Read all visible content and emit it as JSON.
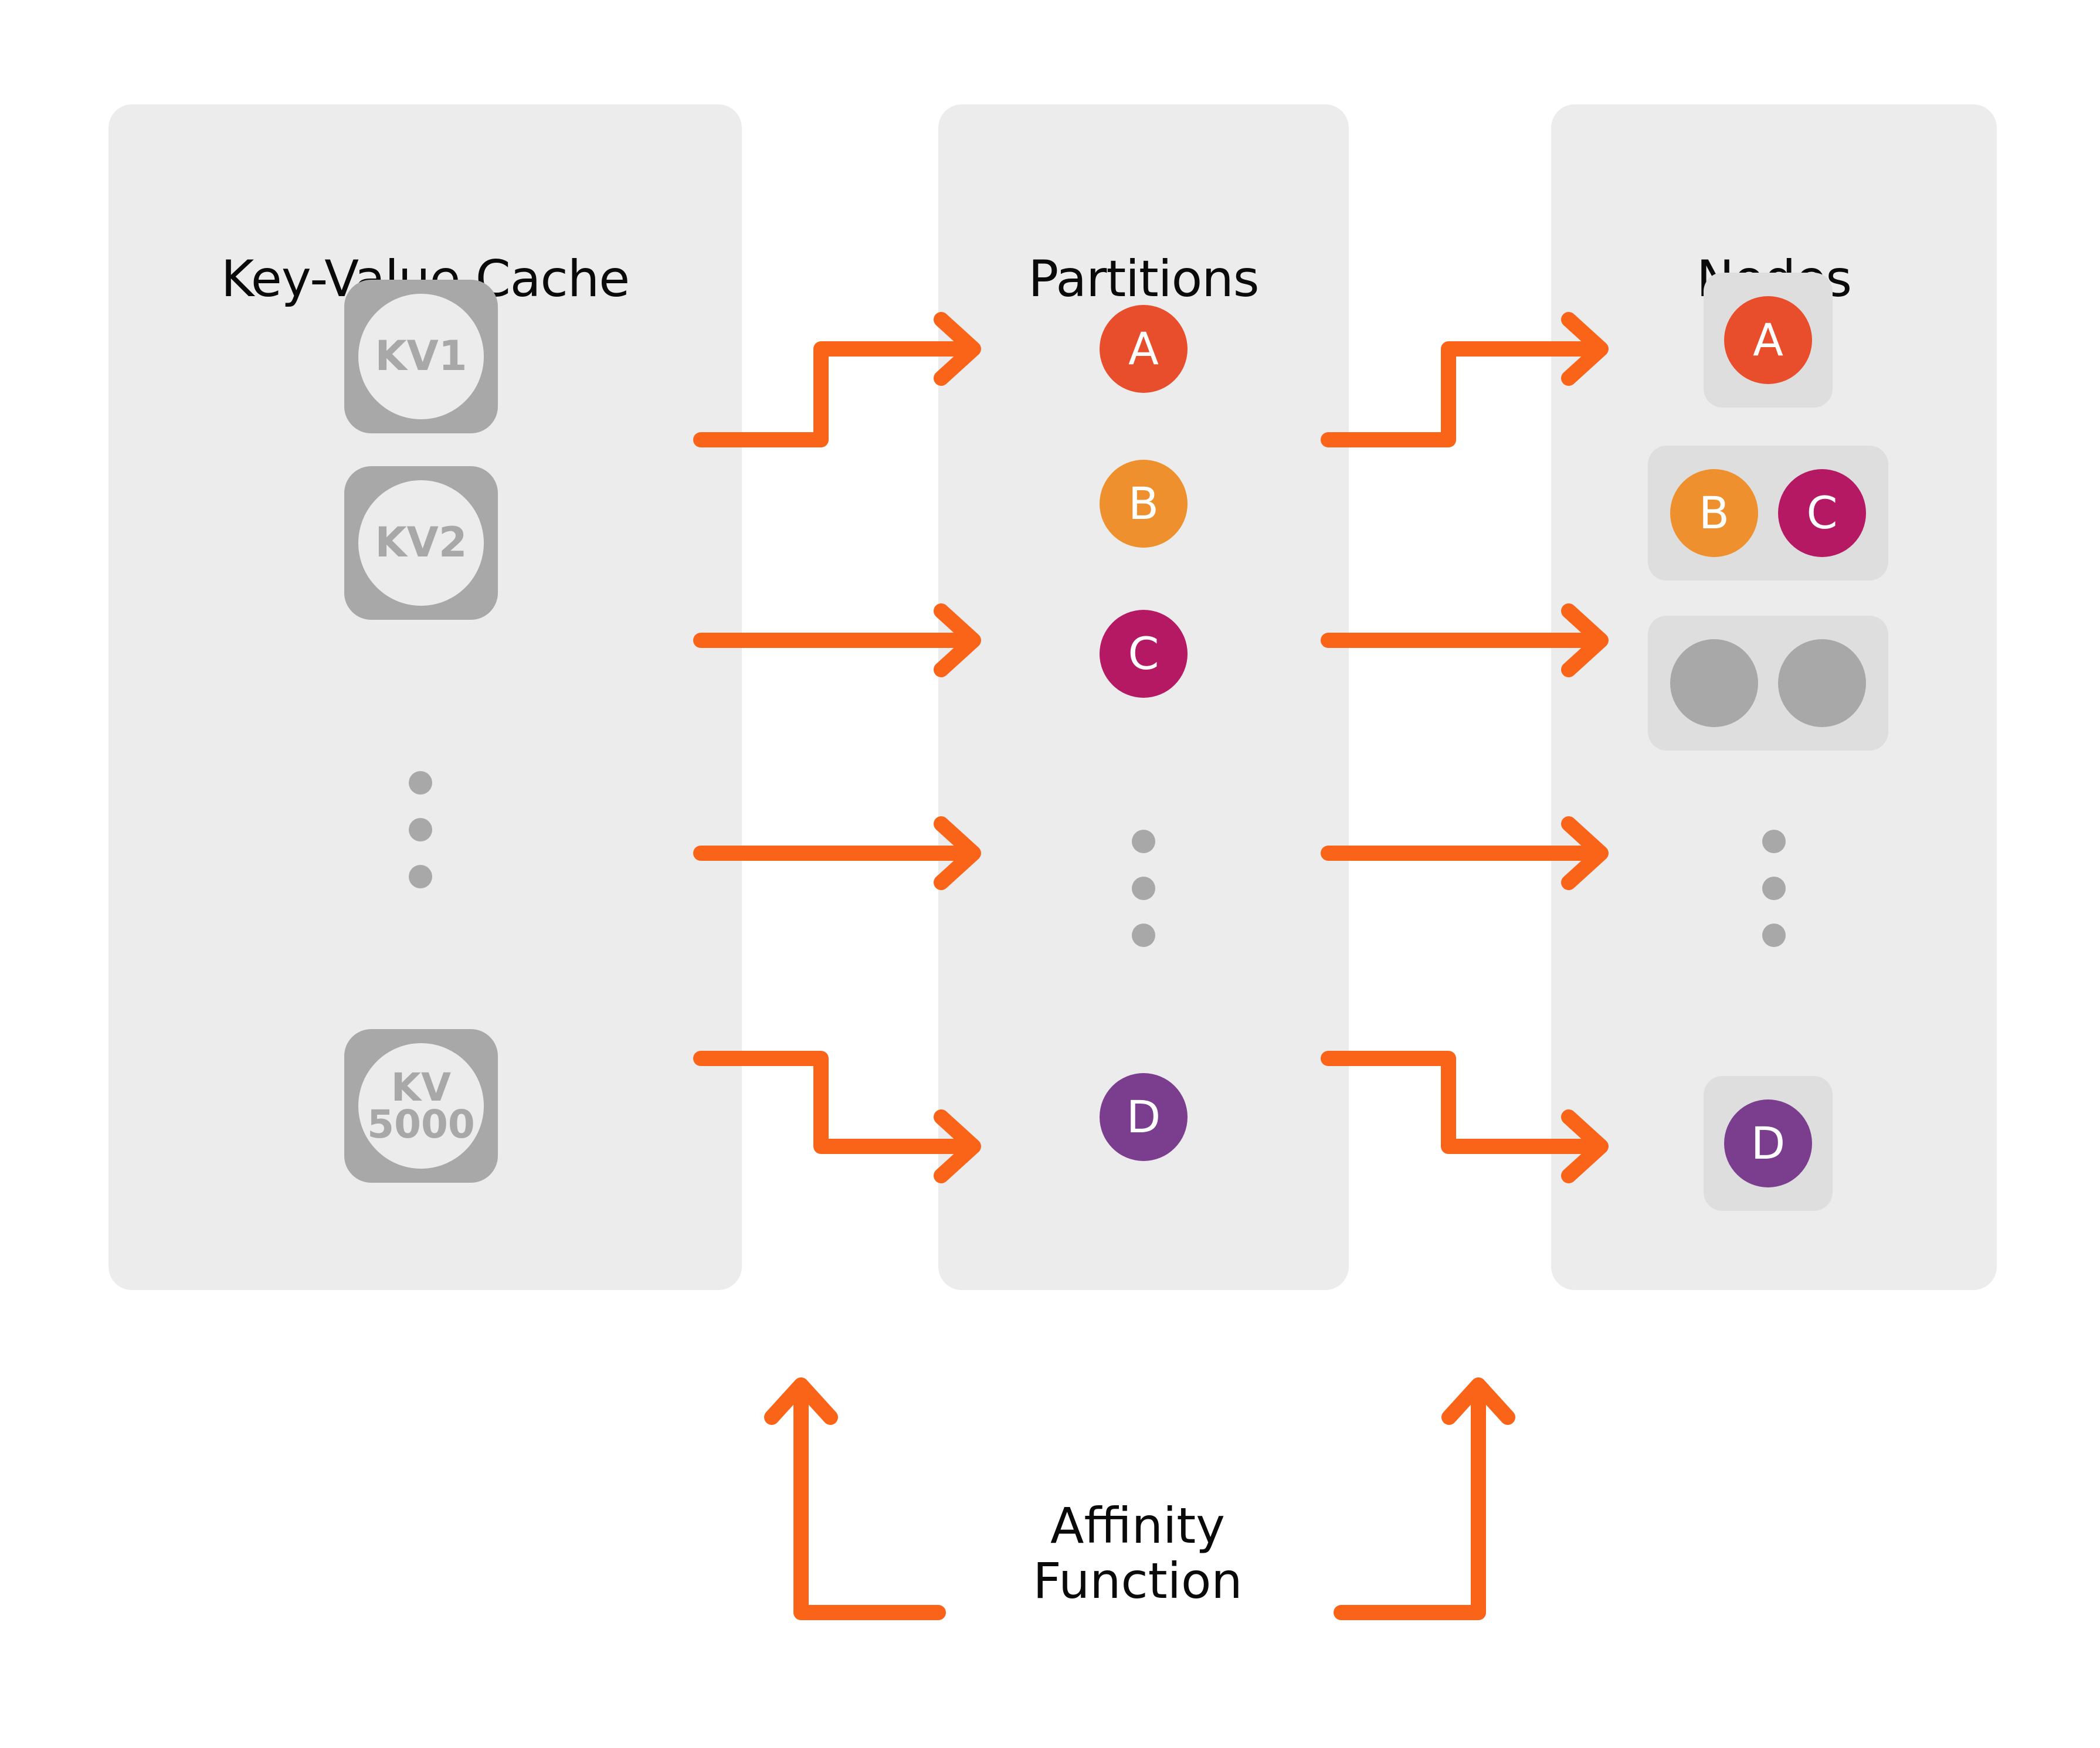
{
  "diagram": {
    "title_columns": [
      "Key-Value Cache",
      "Partitions",
      "Nodes"
    ],
    "accent_orange": "#FA6419",
    "panel_bg": "#ECECEC",
    "node_box_bg": "#DEDEDE",
    "gray": "#A8A8A8"
  },
  "columns": {
    "key_value_cache": {
      "title": "Key-Value Cache",
      "items": [
        {
          "label": "KV1",
          "lines": [
            "KV1"
          ]
        },
        {
          "label": "KV2",
          "lines": [
            "KV2"
          ]
        },
        {
          "label": "KV 5000",
          "lines": [
            "KV",
            "5000"
          ]
        }
      ],
      "ellipsis": "⋮"
    },
    "partitions": {
      "title": "Partitions",
      "items": [
        {
          "label": "A",
          "color": "#E84E2C"
        },
        {
          "label": "B",
          "color": "#EF902F"
        },
        {
          "label": "C",
          "color": "#B51963"
        },
        {
          "label": "D",
          "color": "#7B3E8E"
        }
      ],
      "ellipsis": "⋮"
    },
    "nodes": {
      "title": "Nodes",
      "boxes": [
        {
          "name": "node-1",
          "circles": [
            {
              "label": "A",
              "color": "#E84E2C"
            }
          ]
        },
        {
          "name": "node-2",
          "circles": [
            {
              "label": "B",
              "color": "#EF902F"
            },
            {
              "label": "C",
              "color": "#B51963"
            }
          ]
        },
        {
          "name": "node-3",
          "circles": [
            {
              "label": "",
              "color": "#A8A8A8"
            },
            {
              "label": "",
              "color": "#A8A8A8"
            }
          ]
        },
        {
          "name": "node-4",
          "circles": [
            {
              "label": "D",
              "color": "#7B3E8E"
            }
          ]
        }
      ],
      "ellipsis": "⋮"
    }
  },
  "affinity": {
    "label": "Affinity\nFunction",
    "arrow_color": "#FA6419"
  },
  "arrows": {
    "cache_to_partitions": [
      {
        "name": "kv-to-partition-a",
        "type": "step-up"
      },
      {
        "name": "kv-to-partition-c",
        "type": "straight"
      },
      {
        "name": "kv-to-partition-ellipsis",
        "type": "straight"
      },
      {
        "name": "kv-to-partition-d",
        "type": "step-down"
      }
    ],
    "partitions_to_nodes": [
      {
        "name": "partition-to-node-a",
        "type": "step-up"
      },
      {
        "name": "partition-to-node-c",
        "type": "straight"
      },
      {
        "name": "partition-to-node-ellipsis",
        "type": "straight"
      },
      {
        "name": "partition-to-node-d",
        "type": "step-down"
      }
    ],
    "affinity_callouts": [
      {
        "name": "affinity-arrow-left",
        "type": "elbow-up"
      },
      {
        "name": "affinity-arrow-right",
        "type": "elbow-up"
      }
    ]
  }
}
